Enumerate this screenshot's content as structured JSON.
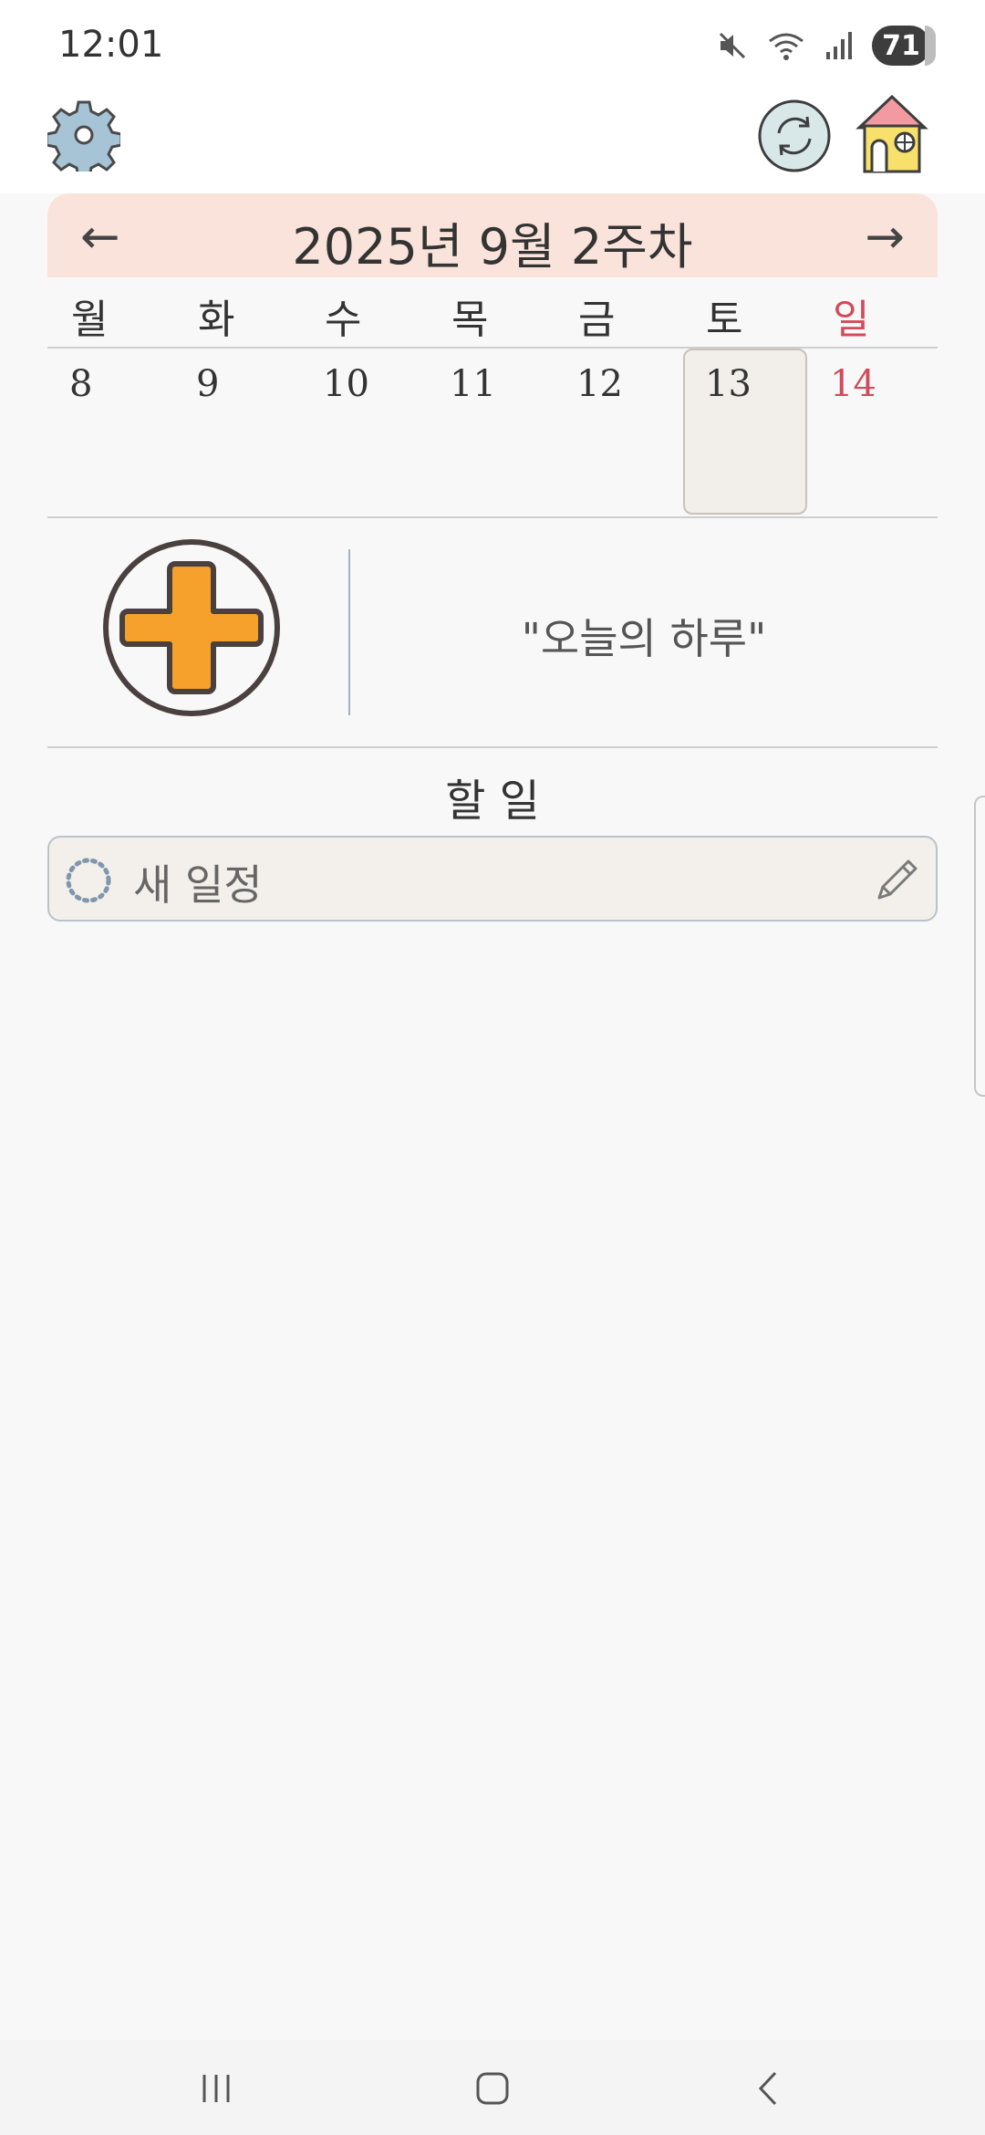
{
  "status_bar": {
    "time": "12:01",
    "battery": "71",
    "icons": [
      "mute-icon",
      "wifi-icon",
      "signal-icon",
      "battery-icon"
    ]
  },
  "app_bar": {
    "icons": [
      "gear-icon",
      "refresh-icon",
      "house-icon"
    ]
  },
  "week": {
    "title": "2025년 9월 2주차",
    "prev_arrow": "←",
    "next_arrow": "→",
    "days": [
      "월",
      "화",
      "수",
      "목",
      "금",
      "토",
      "일"
    ],
    "dates": [
      "8",
      "9",
      "10",
      "11",
      "12",
      "13",
      "14"
    ],
    "selected_date": "13",
    "sunday_color": "#d24b5a"
  },
  "today": {
    "quote": "\"오늘의 하루\"",
    "add_icon": "plus-icon",
    "accent": "#f6a12b"
  },
  "tasks": {
    "title": "할 일",
    "placeholder": "새 일정",
    "icons": [
      "spinner-icon",
      "pencil-icon"
    ]
  },
  "nav_bar": {
    "icons": [
      "recent-apps-icon",
      "home-icon",
      "back-icon"
    ]
  }
}
